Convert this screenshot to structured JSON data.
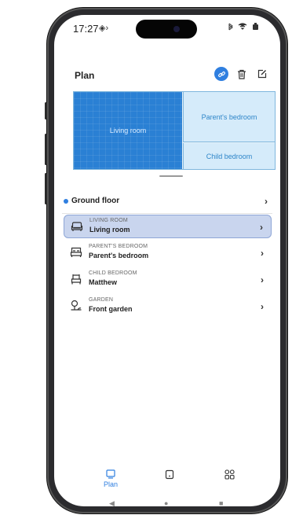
{
  "status": {
    "time": "17:27",
    "nfc_glyph": "◈›"
  },
  "header": {
    "title": "Plan",
    "icons": [
      "link-icon",
      "trash-icon",
      "edit-icon"
    ]
  },
  "plan": {
    "rooms": {
      "living": "Living room",
      "parent": "Parent's bedroom",
      "child": "Child bedroom"
    }
  },
  "floor": {
    "label": "Ground floor",
    "chevron": "›"
  },
  "list": [
    {
      "category": "LIVING ROOM",
      "name": "Living room",
      "icon": "sofa-icon",
      "selected": true
    },
    {
      "category": "PARENT'S BEDROOM",
      "name": "Parent's bedroom",
      "icon": "bed-icon",
      "selected": false
    },
    {
      "category": "CHILD BEDROOM",
      "name": "Matthew",
      "icon": "child-bed-icon",
      "selected": false
    },
    {
      "category": "GARDEN",
      "name": "Front garden",
      "icon": "garden-icon",
      "selected": false
    }
  ],
  "bottom_nav": {
    "items": [
      {
        "icon": "plan-icon",
        "label": "Plan",
        "active": true
      },
      {
        "icon": "device-icon",
        "label": "",
        "active": false
      },
      {
        "icon": "grid-icon",
        "label": "",
        "active": false
      }
    ]
  },
  "colors": {
    "accent": "#2f7fe0",
    "living_room": "#2a80d4",
    "room_fill": "#d5ebfa",
    "selected_row": "#c9d5ee"
  }
}
